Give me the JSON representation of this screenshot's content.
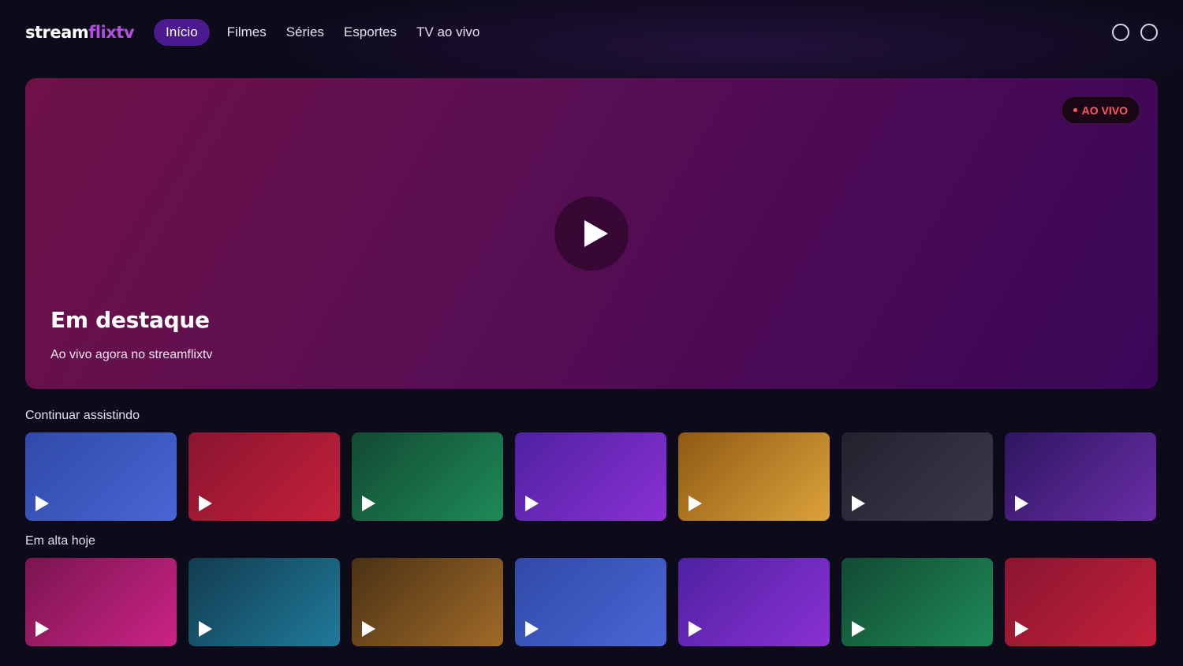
{
  "header": {
    "logo_part1": "stream",
    "logo_part2": "flixtv",
    "nav": [
      "Início",
      "Filmes",
      "Séries",
      "Esportes",
      "TV ao vivo"
    ],
    "active_nav": "Início"
  },
  "hero": {
    "badge": "AO VIVO",
    "title": "Em destaque",
    "subtitle": "Ao vivo agora no streamflixtv"
  },
  "rows": [
    {
      "title": "Continuar assistindo",
      "cards": [
        {
          "colors": [
            "#2f4aa8",
            "#4a66d4"
          ]
        },
        {
          "colors": [
            "#8a1530",
            "#c4203a"
          ]
        },
        {
          "colors": [
            "#124a33",
            "#1e8a58"
          ]
        },
        {
          "colors": [
            "#4e22a0",
            "#8a30d4"
          ]
        },
        {
          "colors": [
            "#8f5a14",
            "#dca23a"
          ]
        },
        {
          "colors": [
            "#22222e",
            "#3a3a4c"
          ]
        },
        {
          "colors": [
            "#2e1660",
            "#6a2ea8"
          ]
        }
      ]
    },
    {
      "title": "Em alta hoje",
      "cards": [
        {
          "colors": [
            "#7a1550",
            "#cc2386"
          ]
        },
        {
          "colors": [
            "#123c50",
            "#1f7a9a"
          ]
        },
        {
          "colors": [
            "#4a3214",
            "#a06a28"
          ]
        },
        {
          "colors": [
            "#2f4aa8",
            "#4a66d4"
          ]
        },
        {
          "colors": [
            "#4e22a0",
            "#8a30d4"
          ]
        },
        {
          "colors": [
            "#124a33",
            "#1e8a58"
          ]
        },
        {
          "colors": [
            "#8a1530",
            "#c4203a"
          ]
        }
      ]
    }
  ]
}
